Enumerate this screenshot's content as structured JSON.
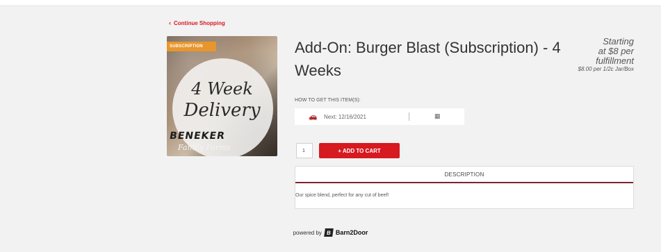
{
  "nav": {
    "continue_icon": "chevron-left-icon",
    "continue_label": "Continue Shopping"
  },
  "product": {
    "badge": "SUBSCRIPTION",
    "image_text_line1": "4 Week",
    "image_text_line2": "Delivery",
    "image_brand": "BENEKER",
    "image_brand_sub": "Family Farms",
    "title": "Add-On: Burger Blast (Subscription) - 4 Weeks",
    "price_line1": "Starting",
    "price_line2": "at $8 per",
    "price_line3": "fulfillment",
    "price_unit": "$8.00 per 1/2c Jar/Box"
  },
  "fulfillment": {
    "heading": "HOW TO GET THIS ITEM(S):",
    "method_icon": "car-icon",
    "next_date": "Next: 12/16/2021",
    "calendar_icon": "calendar-icon"
  },
  "cart": {
    "quantity": "1",
    "add_label": "+ ADD TO CART"
  },
  "description": {
    "tab_label": "DESCRIPTION",
    "text": "Our spice blend, perfect for any cut of beef!"
  },
  "footer": {
    "powered_by": "powered by",
    "brand": "Barn2Door"
  },
  "colors": {
    "accent": "#d71920",
    "badge": "#e8962c",
    "desc_underline": "#7b2330",
    "background": "#f2f2f2"
  }
}
